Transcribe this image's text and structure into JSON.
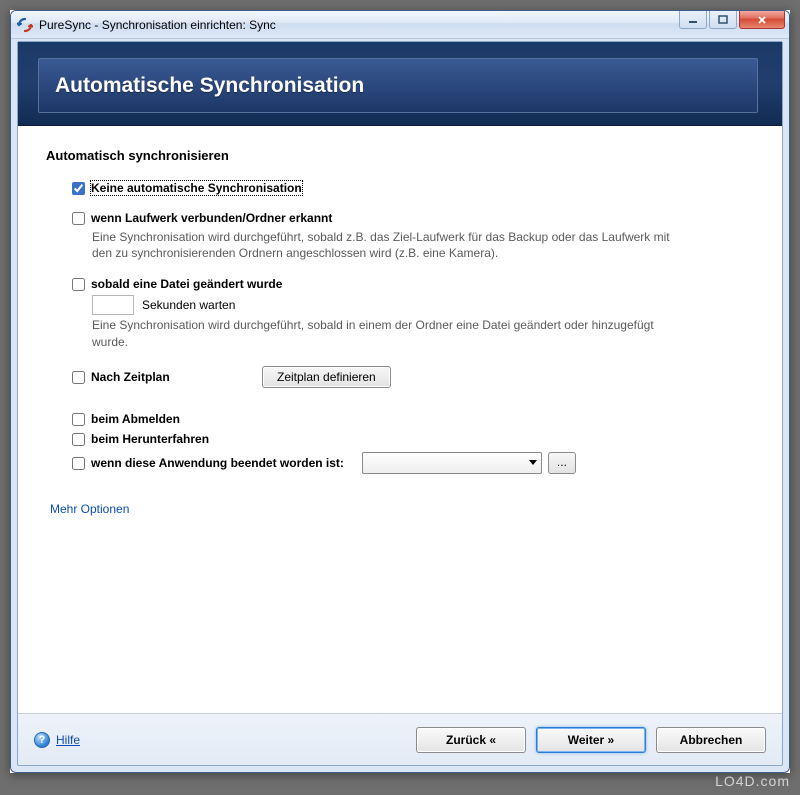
{
  "window": {
    "title": "PureSync - Synchronisation einrichten: Sync"
  },
  "banner": {
    "title": "Automatische Synchronisation"
  },
  "section": {
    "heading": "Automatisch synchronisieren"
  },
  "options": {
    "none": {
      "label": "Keine automatische Synchronisation",
      "checked": true
    },
    "drive": {
      "label": "wenn Laufwerk verbunden/Ordner erkannt",
      "checked": false,
      "desc": "Eine Synchronisation wird durchgeführt, sobald z.B. das Ziel-Laufwerk für das Backup oder das Laufwerk mit den zu synchronisierenden Ordnern angeschlossen wird (z.B. eine Kamera)."
    },
    "fileChanged": {
      "label": "sobald eine Datei geändert wurde",
      "checked": false,
      "secondsValue": "",
      "secondsLabel": "Sekunden warten",
      "desc": "Eine Synchronisation wird durchgeführt, sobald in einem der Ordner eine Datei geändert oder hinzugefügt wurde."
    },
    "schedule": {
      "label": "Nach Zeitplan",
      "checked": false,
      "button": "Zeitplan definieren"
    },
    "logoff": {
      "label": "beim Abmelden",
      "checked": false
    },
    "shutdown": {
      "label": "beim Herunterfahren",
      "checked": false
    },
    "appExit": {
      "label": "wenn diese Anwendung beendet worden ist:",
      "checked": false,
      "appSelected": "",
      "browse": "..."
    }
  },
  "links": {
    "moreOptions": "Mehr Optionen",
    "help": "Hilfe"
  },
  "footer": {
    "back": "Zurück «",
    "next": "Weiter »",
    "cancel": "Abbrechen"
  },
  "watermark": "LO4D.com"
}
